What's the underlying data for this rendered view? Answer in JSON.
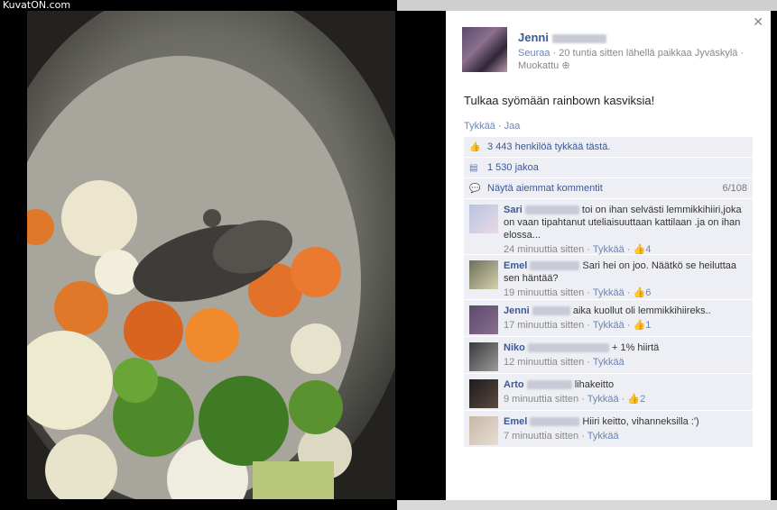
{
  "watermark": "KuvatON.com",
  "post": {
    "author": "Jenni",
    "follow": "Seuraa",
    "time_location": "20 tuntia sitten lähellä paikkaa Jyväskylä",
    "edited": "Muokattu",
    "text": "Tulkaa syömään rainbown kasviksia!",
    "like_action": "Tykkää",
    "share_action": "Jaa"
  },
  "stats": {
    "likes": "3 443 henkilöä tykkää tästä.",
    "shares": "1 530 jakoa",
    "view_previous": "Näytä aiemmat kommentit",
    "comment_count": "6/108"
  },
  "comments": [
    {
      "name": "Sari",
      "text": "toi on ihan selvästi lemmikkihiiri,joka on vaan tipahtanut uteliaisuuttaan kattilaan .ja on ihan elossa...",
      "time": "24 minuuttia sitten",
      "like": "Tykkää",
      "likes": "4"
    },
    {
      "name": "Emel",
      "text": "Sari hei on joo. Näätkö se heiluttaa sen häntää?",
      "time": "19 minuuttia sitten",
      "like": "Tykkää",
      "likes": "6"
    },
    {
      "name": "Jenni",
      "text": "aika kuollut oli lemmikkihiireks..",
      "time": "17 minuuttia sitten",
      "like": "Tykkää",
      "likes": "1"
    },
    {
      "name": "Niko",
      "text": "+ 1% hiirtä",
      "time": "12 minuuttia sitten",
      "like": "Tykkää",
      "likes": ""
    },
    {
      "name": "Arto",
      "text": "lihakeitto",
      "time": "9 minuuttia sitten",
      "like": "Tykkää",
      "likes": "2"
    },
    {
      "name": "Emel",
      "text": "Hiiri keitto, vihanneksilla :')",
      "time": "7 minuuttia sitten",
      "like": "Tykkää",
      "likes": ""
    }
  ]
}
